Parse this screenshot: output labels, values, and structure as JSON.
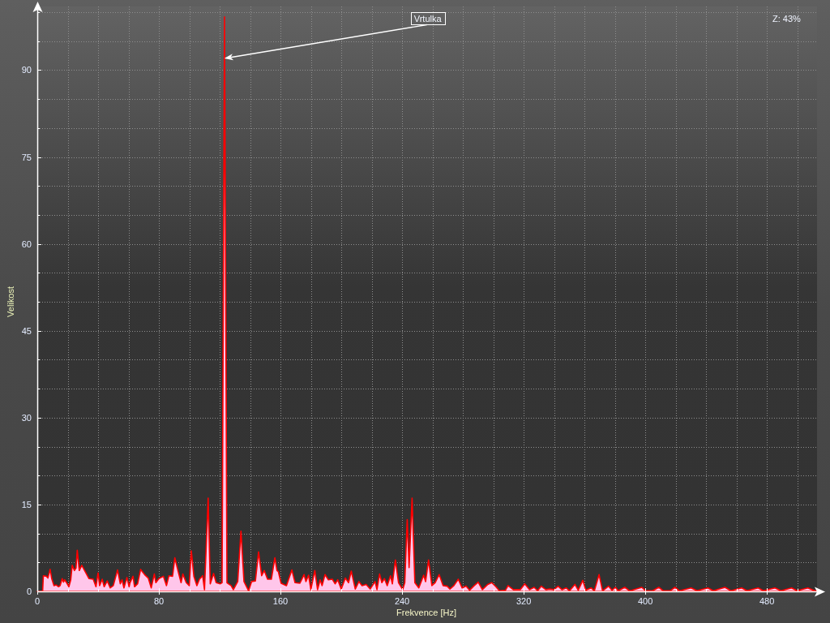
{
  "chart": {
    "zoom_indicator": "Z: 43%",
    "chart_data": {
      "type": "area",
      "xlabel": "Frekvence [Hz]",
      "ylabel": "Velikost",
      "xlim": [
        0,
        513
      ],
      "ylim": [
        0,
        100
      ],
      "xticks": [
        0,
        80,
        160,
        240,
        320,
        400,
        480
      ],
      "yticks": [
        0,
        15,
        30,
        45,
        60,
        75,
        90
      ],
      "grid": true,
      "x": [
        0,
        3.5,
        4,
        6,
        7,
        8.4,
        9.5,
        11,
        12.5,
        14,
        15,
        16.4,
        17.2,
        18,
        19.5,
        20.8,
        22,
        23,
        24.4,
        25.5,
        26.3,
        27.6,
        29.3,
        31.5,
        34,
        36.8,
        38.6,
        40,
        41,
        42.7,
        44,
        46,
        48,
        50,
        52.8,
        54.6,
        55.8,
        57,
        59,
        60.4,
        61,
        63,
        64,
        66,
        68,
        70.6,
        73,
        75,
        77,
        78,
        80,
        83,
        85,
        86.6,
        89,
        90.5,
        93,
        94.6,
        95.8,
        98,
        100,
        101.3,
        103,
        105,
        106.7,
        108.8,
        110,
        112.4,
        113.8,
        116,
        117.7,
        120.4,
        121.6,
        123.2,
        124.8,
        125.7,
        127.5,
        129,
        131.9,
        134,
        136,
        139,
        141,
        143.5,
        145.6,
        147.6,
        149.3,
        151.5,
        154,
        156.3,
        157.7,
        158.6,
        160.4,
        163.9,
        167.5,
        169.6,
        172.8,
        175.5,
        176.7,
        178.5,
        180,
        182.6,
        184.4,
        186.1,
        187.4,
        189.3,
        191.5,
        194.1,
        195.9,
        197.7,
        200,
        202.7,
        204.8,
        206.6,
        209.2,
        211.6,
        213.7,
        216.4,
        219,
        222.2,
        223.5,
        225.2,
        226.7,
        228.4,
        230.2,
        232.4,
        233.6,
        235.6,
        237.7,
        240.4,
        241.8,
        243.4,
        244.6,
        246.6,
        248.4,
        251,
        254.2,
        255.5,
        257.4,
        259.6,
        261.7,
        264.4,
        267,
        269.7,
        271.5,
        274.1,
        277,
        279.5,
        282.1,
        284.4,
        287.5,
        290.1,
        292.8,
        296.4,
        299,
        301.7,
        304,
        308,
        309.7,
        313.2,
        317.7,
        320.7,
        323.9,
        326.9,
        329.2,
        331.6,
        334.6,
        337.2,
        339.9,
        342.6,
        345.2,
        347.9,
        350.2,
        353.7,
        355.9,
        358.9,
        360.9,
        364.4,
        366.5,
        369.6,
        371.9,
        375.8,
        378.1,
        380.4,
        382.2,
        386.5,
        389.7,
        391.4,
        397.7,
        400.3,
        404.8,
        408.9,
        411.9,
        416.3,
        419.5,
        422.5,
        430.2,
        434.1,
        441.2,
        444.8,
        452.4,
        456.3,
        463.4,
        467,
        474.3,
        477.7,
        485.3,
        489.2,
        496.3,
        499.9,
        507,
        511.4,
        513
      ],
      "series": [
        {
          "color": "#ff0000",
          "values": [
            0,
            0,
            2.7,
            2.6,
            2.3,
            3.8,
            2.2,
            1.0,
            1.1,
            0.8,
            1.0,
            2.2,
            1.6,
            2.0,
            1.4,
            0.8,
            2.0,
            4.5,
            3.6,
            4.0,
            7.1,
            3.6,
            4.5,
            3.4,
            2.2,
            2.1,
            0.8,
            3.2,
            1.0,
            2.1,
            0.8,
            1.8,
            0.6,
            1.0,
            3.7,
            1.3,
            2.0,
            0.6,
            2.4,
            0.8,
            1.5,
            2.6,
            0.8,
            1.3,
            3.8,
            2.9,
            2.3,
            0.6,
            3.0,
            1.5,
            2.2,
            2.6,
            1.0,
            2.7,
            2.6,
            5.8,
            3.1,
            1.5,
            3.0,
            1.5,
            1.0,
            7.0,
            2.6,
            1.0,
            2.1,
            2.7,
            0.3,
            16.1,
            1.3,
            3.1,
            1.5,
            1.3,
            1.5,
            99.2,
            1.5,
            1.3,
            1.0,
            0.3,
            1.7,
            10.4,
            1.7,
            0.1,
            1.7,
            1.8,
            6.8,
            2.7,
            3.6,
            2.1,
            2.1,
            5.8,
            3.6,
            3.4,
            1.4,
            1.0,
            3.7,
            1.5,
            1.4,
            2.9,
            1.7,
            2.8,
            0.3,
            3.6,
            0.3,
            2.0,
            1.0,
            2.9,
            2.0,
            2.1,
            1.3,
            2.0,
            0.4,
            2.3,
            1.5,
            3.5,
            0.4,
            1.7,
            1.0,
            1.2,
            0.4,
            1.7,
            0.3,
            3.0,
            1.5,
            2.2,
            1.0,
            2.7,
            1.3,
            5.4,
            1.5,
            0.3,
            1.5,
            12.4,
            4.1,
            16.1,
            1.5,
            0.6,
            2.8,
            1.7,
            5.4,
            1.0,
            1.5,
            2.9,
            1.0,
            0.9,
            0.4,
            1.0,
            2.1,
            0.6,
            0.9,
            0.2,
            1.0,
            1.6,
            0.3,
            1.2,
            1.5,
            0.8,
            0.1,
            0.2,
            1.0,
            0.3,
            0.3,
            1.3,
            0.3,
            0.7,
            0.1,
            0.9,
            0.3,
            0.4,
            0.3,
            0.9,
            0.3,
            0.6,
            0.1,
            1.2,
            0.2,
            1.9,
            0.2,
            0.6,
            0.1,
            2.9,
            0.1,
            0.9,
            0.2,
            0.7,
            0.1,
            0.7,
            0.1,
            0.2,
            0.7,
            0.1,
            0.1,
            0.7,
            0.1,
            0.1,
            0.7,
            0.1,
            0.6,
            0.1,
            0.6,
            0.1,
            0.7,
            0.1,
            0.6,
            0.1,
            0.6,
            0.1,
            0.6,
            0.1,
            0.6,
            0.1,
            0.6,
            0.1,
            0.1
          ]
        }
      ],
      "annotations": [
        {
          "text": "Vrtulka",
          "x": 123,
          "y": 92
        }
      ]
    }
  }
}
